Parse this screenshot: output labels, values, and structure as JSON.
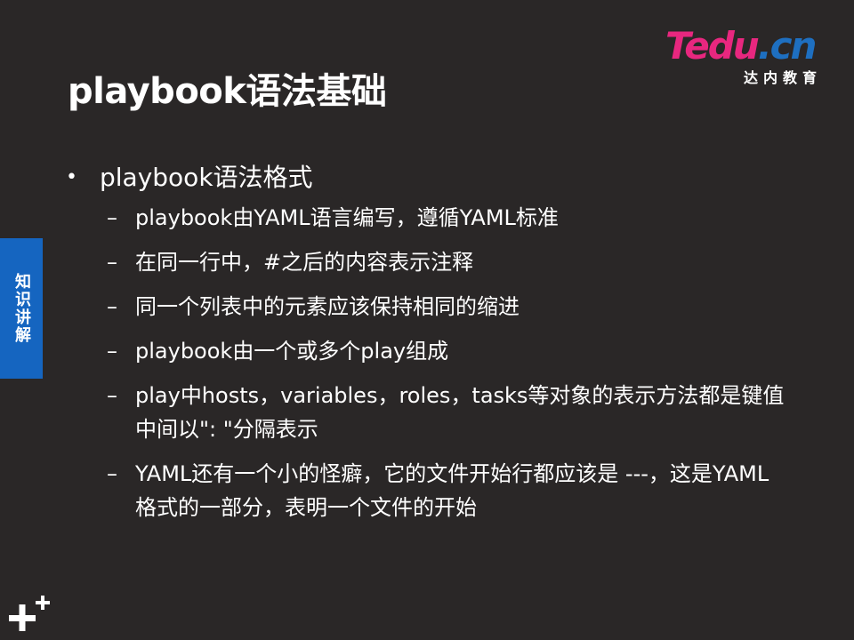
{
  "slide": {
    "title": "playbook语法基础",
    "side_tab": "知识讲解",
    "logo": {
      "brand": "Tedu",
      "tld": ".cn",
      "subtitle": "达内教育"
    }
  },
  "content": {
    "heading": "playbook语法格式",
    "items": [
      "playbook由YAML语言编写，遵循YAML标准",
      "在同一行中，#之后的内容表示注释",
      "同一个列表中的元素应该保持相同的缩进",
      "playbook由一个或多个play组成",
      "play中hosts，variables，roles，tasks等对象的表示方法都是键值中间以\": \"分隔表示",
      "YAML还有一个小的怪癖，它的文件开始行都应该是 ---，这是YAML格式的一部分，表明一个文件的开始"
    ]
  },
  "colors": {
    "background": "#2a2727",
    "side_tab": "#1565c0",
    "logo_pink": "#e8277f",
    "logo_blue": "#1e6fc0"
  }
}
